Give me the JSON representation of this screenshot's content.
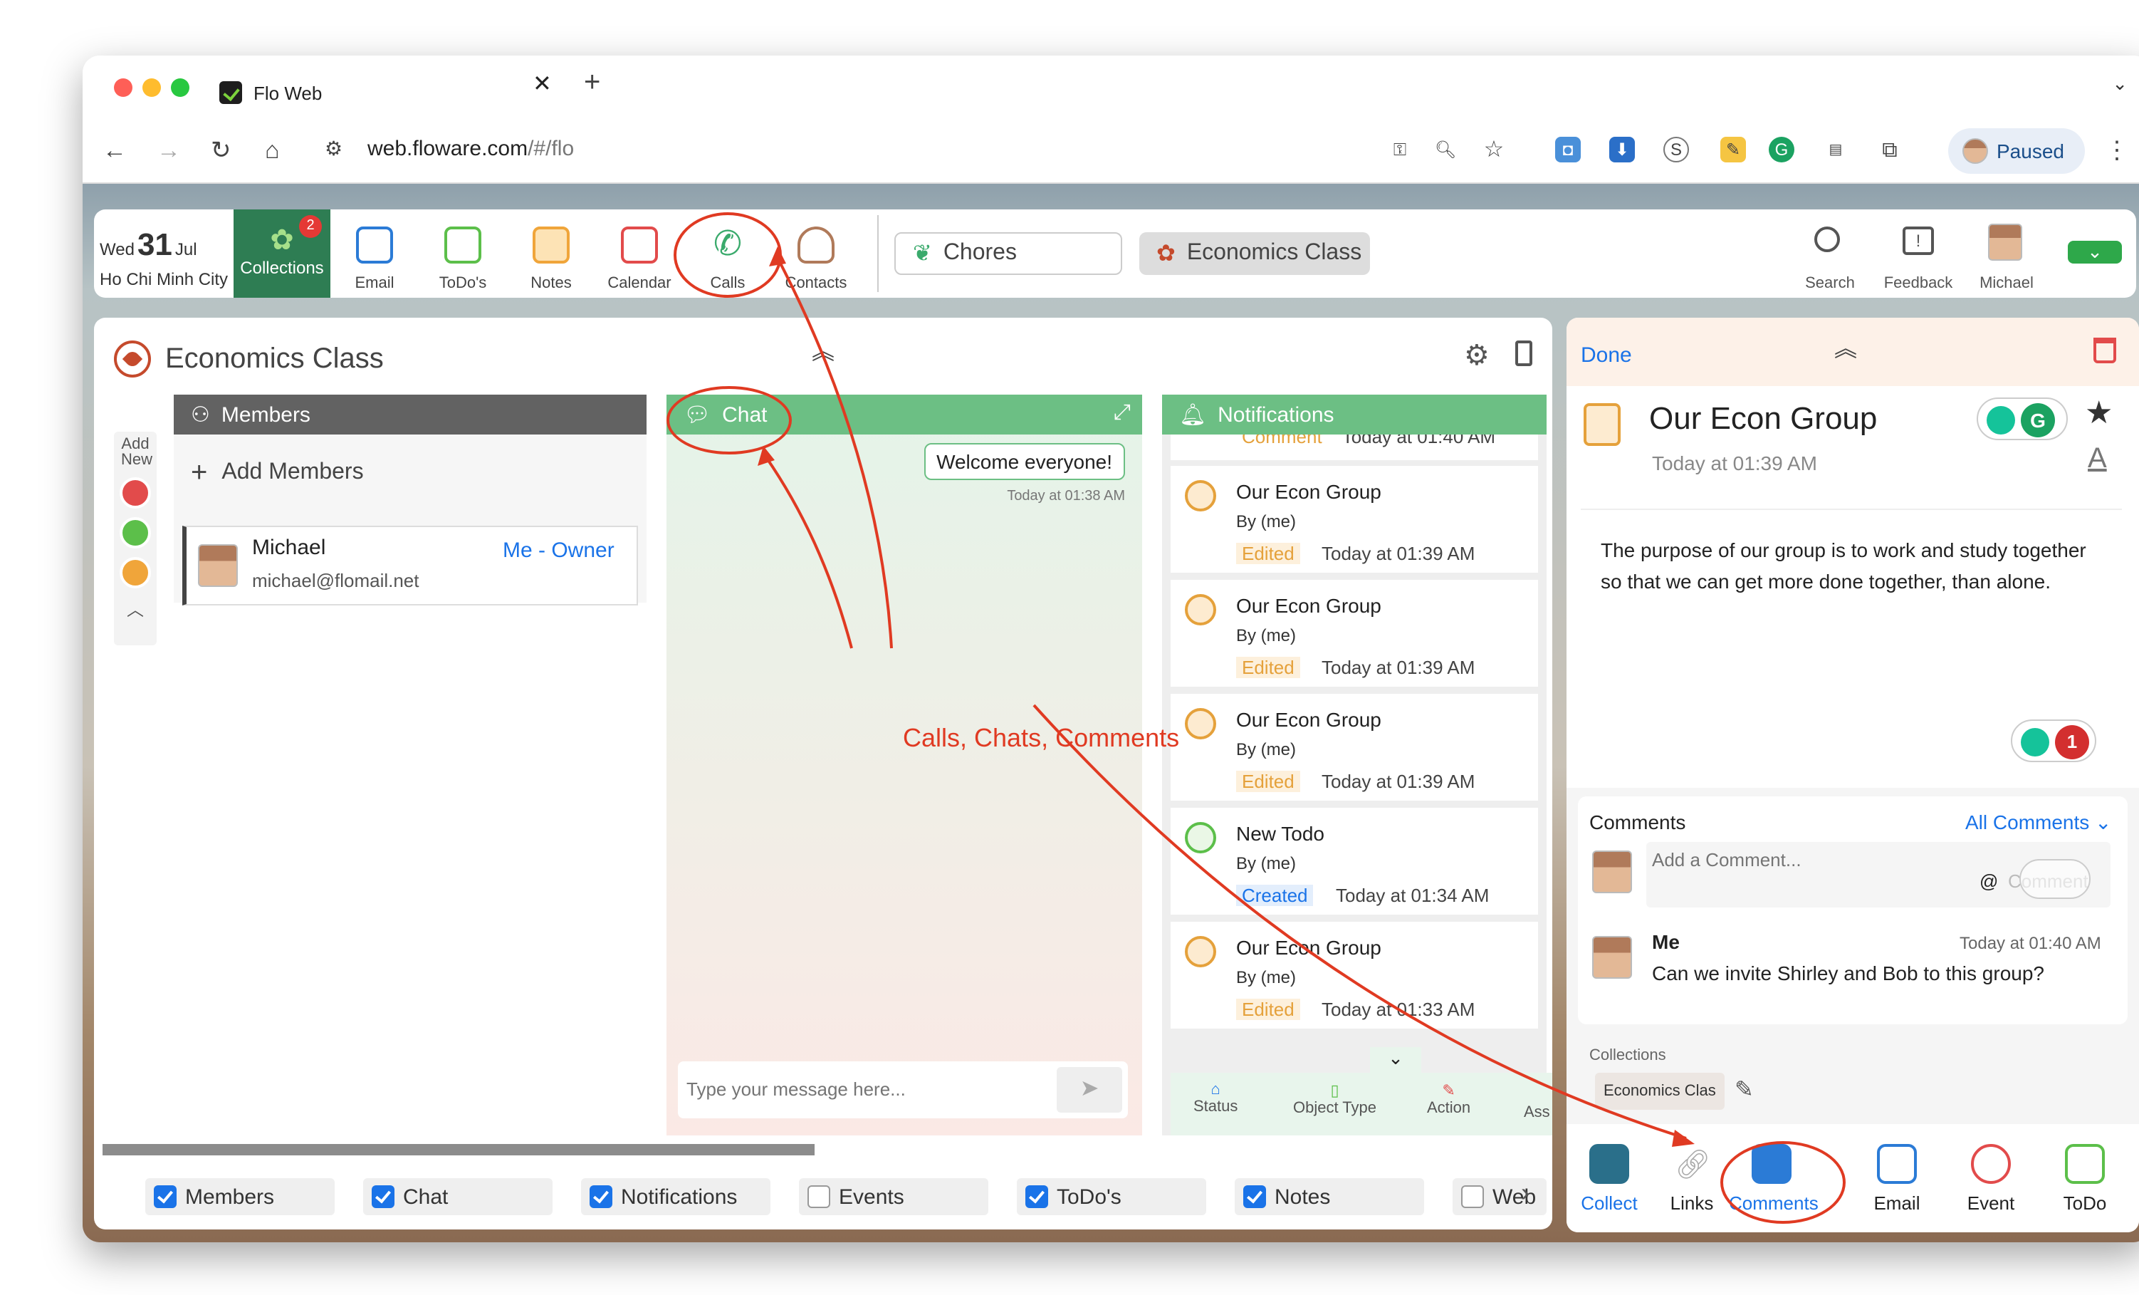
{
  "browser": {
    "tab_title": "Flo Web",
    "url_main": "web.floware.com",
    "url_path": "/#/flo",
    "profile": "Paused"
  },
  "topbar": {
    "day": "Wed",
    "date": "31",
    "month": "Jul",
    "city": "Ho Chi Minh City",
    "collections_label": "Collections",
    "collections_badge": "2",
    "email": "Email",
    "todos": "ToDo's",
    "notes": "Notes",
    "calendar": "Calendar",
    "calls": "Calls",
    "contacts": "Contacts",
    "chip1": "Chores",
    "chip2": "Economics Class",
    "search": "Search",
    "feedback": "Feedback",
    "user": "Michael"
  },
  "main": {
    "title": "Economics Class",
    "add_new": "Add New",
    "members": {
      "header": "Members",
      "add": "Add Members",
      "name": "Michael",
      "role": "Me - Owner",
      "email": "michael@flomail.net"
    },
    "chat": {
      "header": "Chat",
      "message": "Welcome everyone!",
      "time": "Today at 01:38 AM",
      "placeholder": "Type your message here..."
    },
    "notifications": {
      "header": "Notifications",
      "partial_act": "Comment",
      "partial_time": "Today at 01:40 AM",
      "items": [
        {
          "title": "Our Econ Group",
          "by": "By (me)",
          "action": "Edited",
          "time": "Today at 01:39 AM"
        },
        {
          "title": "Our Econ Group",
          "by": "By (me)",
          "action": "Edited",
          "time": "Today at 01:39 AM"
        },
        {
          "title": "Our Econ Group",
          "by": "By (me)",
          "action": "Edited",
          "time": "Today at 01:39 AM"
        },
        {
          "title": "New Todo",
          "by": "By (me)",
          "action": "Created",
          "time": "Today at 01:34 AM"
        },
        {
          "title": "Our Econ Group",
          "by": "By (me)",
          "action": "Edited",
          "time": "Today at 01:33 AM"
        }
      ],
      "tabs": [
        "Status",
        "Object Type",
        "Action",
        "Ass"
      ]
    },
    "checkboxes": [
      {
        "label": "Members",
        "checked": true
      },
      {
        "label": "Chat",
        "checked": true
      },
      {
        "label": "Notifications",
        "checked": true
      },
      {
        "label": "Events",
        "checked": false
      },
      {
        "label": "ToDo's",
        "checked": true
      },
      {
        "label": "Notes",
        "checked": true
      },
      {
        "label": "Web",
        "checked": false
      }
    ]
  },
  "detail": {
    "done": "Done",
    "title": "Our Econ Group",
    "time": "Today at 01:39 AM",
    "body1": "The purpose of our group is to work and study together",
    "body2": "so that we can get more done together, than alone.",
    "grammarly_count": "1",
    "comments": {
      "label": "Comments",
      "all": "All Comments",
      "placeholder": "Add a Comment...",
      "at": "@",
      "ghost": "Comment",
      "author": "Me",
      "time": "Today at 01:40 AM",
      "text": "Can we invite Shirley and Bob to this group?"
    },
    "collections_label": "Collections",
    "collection_tag": "Economics Clas",
    "bottom": [
      "Collect",
      "Links",
      "Comments",
      "Email",
      "Event",
      "ToDo"
    ]
  },
  "annotation": "Calls, Chats, Comments"
}
